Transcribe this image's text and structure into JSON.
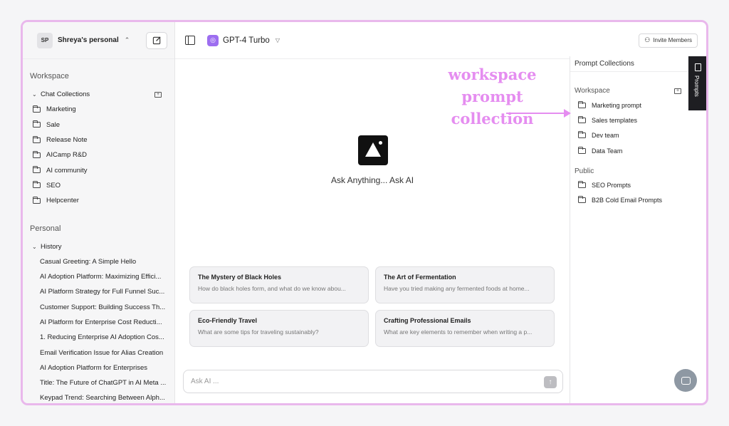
{
  "account": {
    "initials": "SP",
    "name": "Shreya's personal"
  },
  "model": {
    "name": "GPT-4 Turbo"
  },
  "header": {
    "invite_label": "Invite Members"
  },
  "sidebar": {
    "workspace_label": "Workspace",
    "chat_collections_label": "Chat Collections",
    "folders": [
      "Marketing",
      "Sale",
      "Release Note",
      "AICamp R&D",
      "AI community",
      "SEO",
      "Helpcenter"
    ],
    "personal_label": "Personal",
    "history_label": "History",
    "history": [
      "Casual Greeting: A Simple Hello",
      "AI Adoption Platform: Maximizing Effici...",
      "AI Platform Strategy for Full Funnel Suc...",
      "Customer Support: Building Success Th...",
      "AI Platform for Enterprise Cost Reducti...",
      "1. Reducing Enterprise AI Adoption Cos...",
      "Email Verification Issue for Alias Creation",
      "AI Adoption Platform for Enterprises",
      "Title: The Future of ChatGPT in AI Meta ...",
      "Keypad Trend: Searching Between Alph..."
    ]
  },
  "main": {
    "ask_title": "Ask Anything... Ask AI",
    "cards": [
      {
        "title": "The Mystery of Black Holes",
        "desc": "How do black holes form, and what do we know abou..."
      },
      {
        "title": "The Art of Fermentation",
        "desc": "Have you tried making any fermented foods at home..."
      },
      {
        "title": "Eco-Friendly Travel",
        "desc": "What are some tips for traveling sustainably?"
      },
      {
        "title": "Crafting Professional Emails",
        "desc": "What are key elements to remember when writing a p..."
      }
    ],
    "input_placeholder": "Ask AI ..."
  },
  "prompt_panel": {
    "title": "Prompt Collections",
    "workspace_label": "Workspace",
    "workspace_items": [
      "Marketing prompt",
      "Sales templates",
      "Dev team",
      "Data Team"
    ],
    "public_label": "Public",
    "public_items": [
      "SEO Prompts",
      "B2B Cold Email Prompts"
    ],
    "tab_label": "Prompts"
  },
  "annotation": {
    "line1": "workspace prompt",
    "line2": "collection"
  },
  "colors": {
    "frame_border": "#e9b8ec",
    "annotation": "#e58df0",
    "model_icon": "#9d6ef0"
  }
}
